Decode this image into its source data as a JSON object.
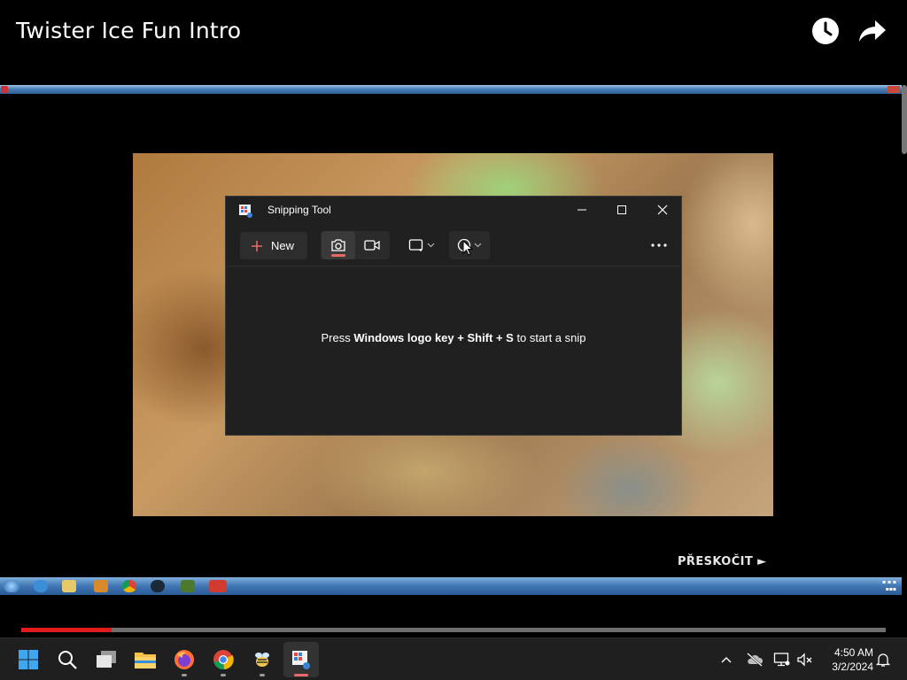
{
  "player": {
    "title": "Twister Ice Fun Intro",
    "skip_label": "PŘESKOČIT ►",
    "progress_fraction": 0.105,
    "icons": {
      "watch_later": "clock-icon",
      "share": "share-icon"
    }
  },
  "snipping_tool": {
    "title": "Snipping Tool",
    "new_label": "New",
    "hint_prefix": "Press ",
    "hint_bold": "Windows logo key + Shift + S",
    "hint_suffix": " to start a snip",
    "active_mode": "photo",
    "accent_color": "#e86a6a"
  },
  "taskbar": {
    "time": "4:50 AM",
    "date": "3/2/2024",
    "apps": [
      "start",
      "search",
      "task-view",
      "file-explorer",
      "firefox",
      "chrome",
      "bee-app",
      "snipping-tool"
    ]
  },
  "colors": {
    "progress": "#e21b1b",
    "window_bg": "#202020",
    "taskbar_bg": "#1f1f1f"
  }
}
